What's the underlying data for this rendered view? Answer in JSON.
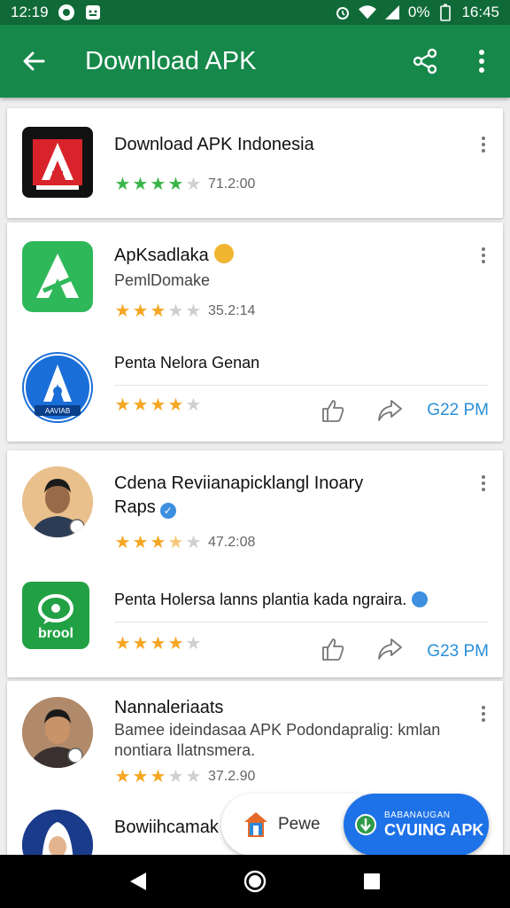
{
  "status_bar": {
    "time_left": "12:19",
    "battery": "0%",
    "time_right": "16:45"
  },
  "app_bar": {
    "title": "Download APK"
  },
  "cards": [
    {
      "rows": [
        {
          "title": "Download APK Indonesia",
          "rating": "71.2:00",
          "stars": 4
        }
      ]
    },
    {
      "rows": [
        {
          "title": "ApKsadlaka",
          "subtitle": "PemlDomake",
          "rating": "35.2:14",
          "stars": 3
        },
        {
          "title": "Penta Nelora Genan",
          "stars": 4,
          "time": "G22 PM"
        }
      ]
    },
    {
      "rows": [
        {
          "title_line1": "Cdena Reviianapicklangl Inoary",
          "title_line2": "Raps",
          "rating": "47.2:08",
          "stars": 3.5
        },
        {
          "title": "Penta Holersa lanns plantia kada ngraira.",
          "stars": 4,
          "time": "G23 PM"
        }
      ]
    },
    {
      "rows": [
        {
          "title": "Nannaleriaats",
          "subtitle_line1": "Bamee ideindasaa APK Podondapralig: kmlan",
          "subtitle_line2": "nontiara Ilatnsmera.",
          "rating": "37.2.90",
          "stars": 3
        },
        {
          "title": "Bowiihcamak"
        }
      ]
    }
  ],
  "icon_texts": {
    "brool": "brool",
    "blue_badge": "AAVIAB"
  },
  "fab_pewe": {
    "label": "Pewe"
  },
  "fab_download": {
    "small_label": "BABANAUGAN",
    "label": "CVUING APK"
  },
  "colors": {
    "status_bar": "#106a38",
    "app_bar": "#16884a",
    "accent_blue": "#2a8fd8",
    "star_green": "#3bb54a",
    "star_orange": "#f5a623",
    "star_gray": "#cfcfcf",
    "fab_blue": "#1e72e8"
  }
}
